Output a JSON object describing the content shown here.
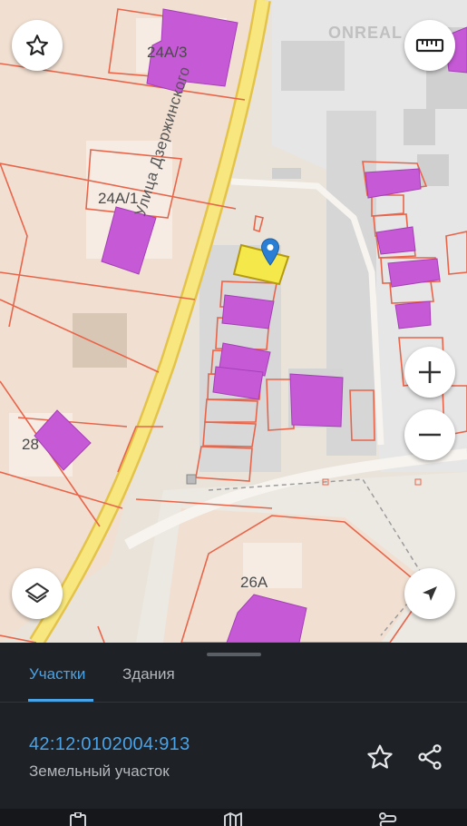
{
  "map": {
    "watermark": "ONREAL",
    "street_name": "Улица Дзержинского",
    "house_labels": [
      "24А/3",
      "24А/1",
      "28",
      "26А"
    ],
    "icons": {
      "favorite": "star-outline-icon",
      "ruler": "ruler-icon",
      "zoom_in": "plus-icon",
      "zoom_out": "minus-icon",
      "layers": "layers-icon",
      "locate": "navigation-arrow-icon",
      "marker": "location-pin-icon"
    },
    "colors": {
      "parcel_outline": "#e8654a",
      "building_fill": "#c65ad6",
      "selected_parcel": "#f4e84a",
      "road": "#f5dc6a",
      "marker": "#2a7fd4"
    }
  },
  "sheet": {
    "tabs": [
      {
        "label": "Участки",
        "active": true
      },
      {
        "label": "Здания",
        "active": false
      }
    ],
    "parcel": {
      "id": "42:12:0102004:913",
      "type": "Земельный участок"
    },
    "actions": {
      "favorite": "star-outline-icon",
      "share": "share-icon"
    },
    "accent_color": "#4aa3e6"
  }
}
